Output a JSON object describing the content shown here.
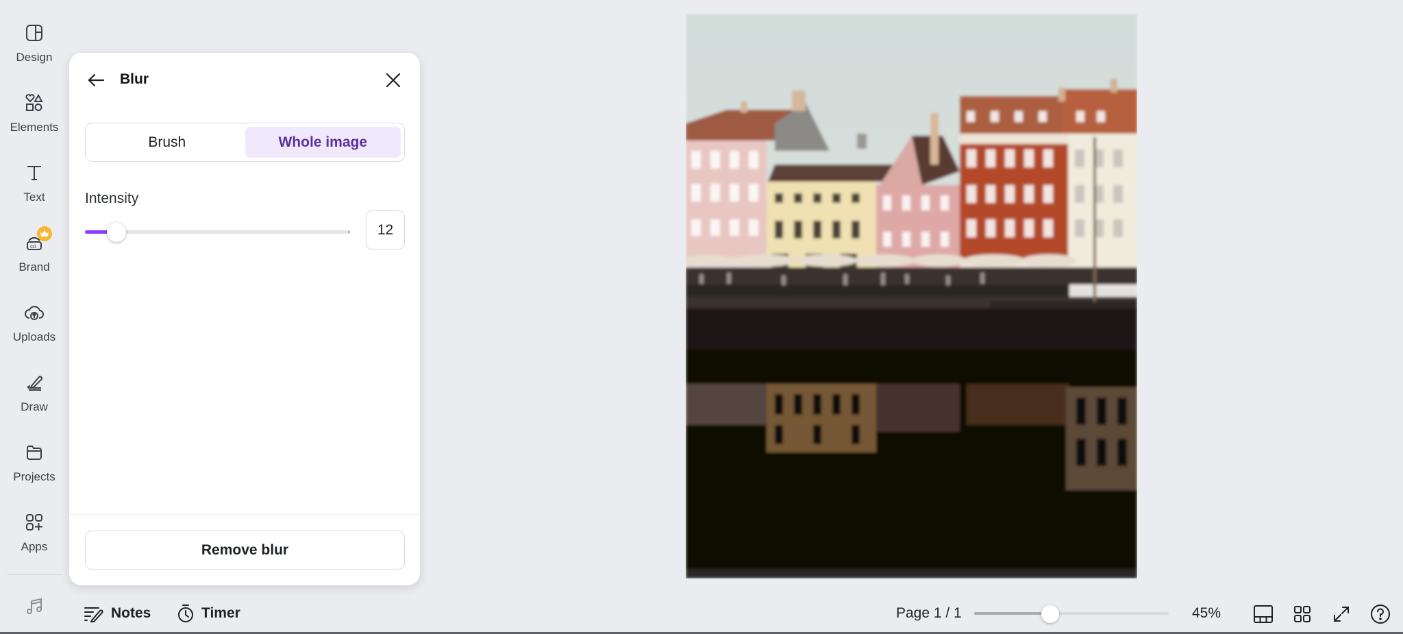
{
  "sidebar": {
    "items": [
      {
        "label": "Design",
        "icon": "layout-icon"
      },
      {
        "label": "Elements",
        "icon": "shapes-icon"
      },
      {
        "label": "Text",
        "icon": "text-icon"
      },
      {
        "label": "Brand",
        "icon": "brand-icon",
        "badge": "crown-icon"
      },
      {
        "label": "Uploads",
        "icon": "cloud-upload-icon"
      },
      {
        "label": "Draw",
        "icon": "pen-icon"
      },
      {
        "label": "Projects",
        "icon": "folder-icon"
      },
      {
        "label": "Apps",
        "icon": "apps-icon"
      }
    ],
    "extra_icon": "music-icon"
  },
  "panel": {
    "title": "Blur",
    "tabs": [
      {
        "label": "Brush",
        "active": false
      },
      {
        "label": "Whole image",
        "active": true
      }
    ],
    "intensity": {
      "label": "Intensity",
      "value": 12,
      "value_text": "12",
      "min": 0,
      "max": 100
    },
    "remove_label": "Remove blur"
  },
  "bottom_bar": {
    "notes_label": "Notes",
    "timer_label": "Timer",
    "page_indicator": "Page 1 / 1",
    "zoom_percent": 45,
    "zoom_label": "45%",
    "zoom_slider_fraction": 0.39
  },
  "colors": {
    "accent": "#8b3dff",
    "active_tab_bg": "#efe9fb",
    "active_tab_text": "#5a2fa1",
    "crown_badge": "#f7b731"
  }
}
